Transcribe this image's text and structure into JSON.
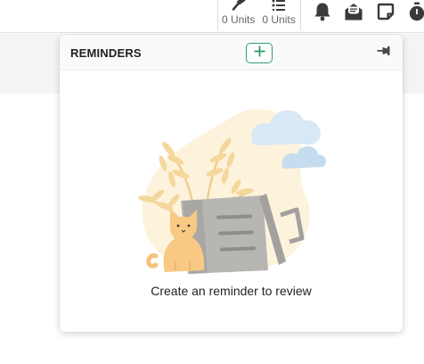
{
  "toolbar": {
    "units": [
      {
        "icon": "hammer-icon",
        "label": "0 Units"
      },
      {
        "icon": "list-icon",
        "label": "0 Units"
      }
    ],
    "icons": [
      "bell-icon",
      "mail-open-icon",
      "note-icon",
      "timer-icon"
    ]
  },
  "reminders": {
    "title": "REMINDERS",
    "add_icon": "plus-icon",
    "pin_icon": "pin-icon",
    "empty_message": "Create an reminder to review",
    "illustration": "cat-trash-can-illustration"
  },
  "colors": {
    "accent_green": "#2e9e6a",
    "icon_dark": "#3a3a3a",
    "header_bg": "#fafafb",
    "band_bg": "#f3f4f6"
  }
}
